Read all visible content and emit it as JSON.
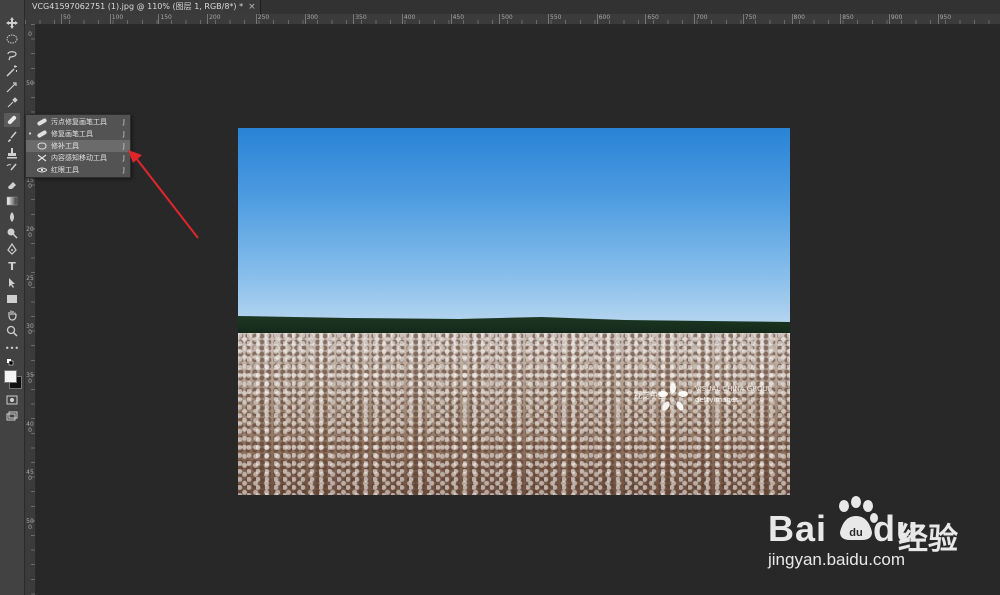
{
  "document_tab": {
    "title": "VCG41597062751 (1).jpg @ 110% (图层 1, RGB/8*) *",
    "close_glyph": "×"
  },
  "rulers": {
    "top_ticks": [
      "50",
      "100",
      "150",
      "200",
      "250",
      "300",
      "350",
      "400",
      "450",
      "500",
      "550",
      "600",
      "650",
      "700",
      "750",
      "800",
      "850",
      "900",
      "950"
    ],
    "left_ticks": [
      "0",
      "50",
      "100",
      "150",
      "200",
      "250",
      "300",
      "350",
      "400",
      "450",
      "500"
    ]
  },
  "toolbar": {
    "tools": [
      "move-icon",
      "marquee-icon",
      "lasso-icon",
      "magic-wand-icon",
      "crop-icon",
      "eyedropper-icon",
      "healing-brush-icon",
      "brush-icon",
      "clone-stamp-icon",
      "history-brush-icon",
      "eraser-icon",
      "gradient-icon",
      "blur-icon",
      "dodge-icon",
      "pen-icon",
      "type-icon",
      "path-selection-icon",
      "rectangle-icon",
      "hand-icon",
      "zoom-icon",
      "more-tools-icon"
    ],
    "type_tool_glyph": "T",
    "more_glyph": "•••",
    "foreground_color": "#f5f5f5",
    "background_color": "#111111"
  },
  "flyout": {
    "items": [
      {
        "label": "污点修复画笔工具",
        "key": "J",
        "bullet": "",
        "icon": "spot-healing-icon"
      },
      {
        "label": "修复画笔工具",
        "key": "J",
        "bullet": "•",
        "icon": "healing-brush-icon"
      },
      {
        "label": "修补工具",
        "key": "J",
        "bullet": "",
        "icon": "patch-icon"
      },
      {
        "label": "内容感知移动工具",
        "key": "J",
        "bullet": "",
        "icon": "content-aware-move-icon"
      },
      {
        "label": "红眼工具",
        "key": "J",
        "bullet": "",
        "icon": "red-eye-icon"
      }
    ],
    "selected_index": 2
  },
  "photo_watermark": {
    "cn": "视觉中国",
    "line1": "VISUAL CHINA GROUP",
    "line2": "gettyimages"
  },
  "annotation_arrow_color": "#e0262b",
  "site_watermark": {
    "brand_left": "Bai",
    "brand_right": "du",
    "cn": "经验",
    "url": "jingyan.baidu.com"
  }
}
